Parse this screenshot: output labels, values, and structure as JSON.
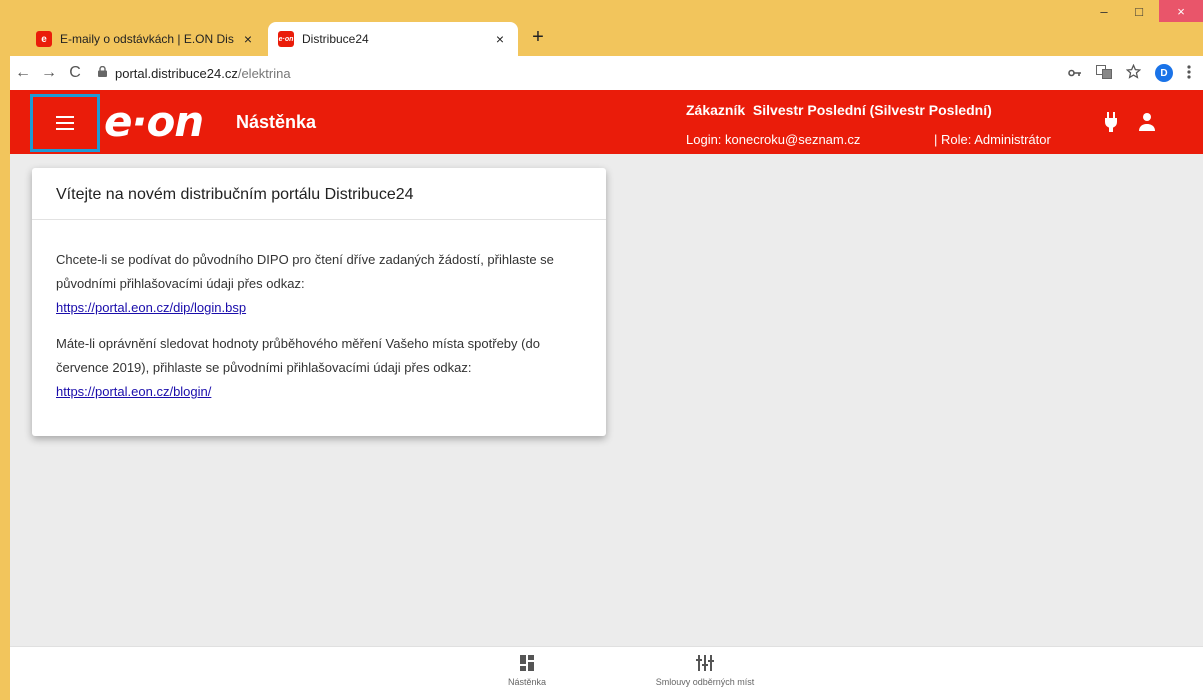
{
  "browser": {
    "tabs": [
      {
        "title": "E-maily o odstávkách | E.ON Dist",
        "favicon": "e",
        "close": "×"
      },
      {
        "title": "Distribuce24",
        "favicon": "e·on",
        "close": "×"
      }
    ],
    "new_tab": "+",
    "window": {
      "minimize": "–",
      "maximize": "□",
      "close": "×"
    },
    "nav": {
      "back": "←",
      "forward": "→",
      "reload": "C"
    },
    "url": {
      "host": "portal.distribuce24.cz",
      "path": "/elektrina"
    },
    "profile_initial": "D",
    "icons": [
      "key-icon",
      "translate-icon",
      "star-icon",
      "more-icon"
    ]
  },
  "header": {
    "logo": "e·on",
    "title": "Nástěnka",
    "customer_label": "Zákazník",
    "customer_name": "Silvestr Poslední (Silvestr Poslední)",
    "login": "Login: konecroku@seznam.cz",
    "role": "| Role: Administrátor",
    "accent_color": "#ea1c0a"
  },
  "card": {
    "title": "Vítejte na novém distribučním portálu Distribuce24",
    "para1_text": "Chcete-li se podívat do původního DIPO pro čtení dříve zadaných žádostí, přihlaste se původními přihlašovacími údaji přes odkaz:",
    "para1_link": "https://portal.eon.cz/dip/login.bsp",
    "para2_text": "Máte-li oprávnění sledovat hodnoty průběhového měření Vašeho místa spotřeby (do července 2019), přihlaste se původními přihlašovacími údaji přes odkaz:",
    "para2_link": "https://portal.eon.cz/blogin/"
  },
  "bottom_nav": {
    "dashboard": "Nástěnka",
    "contracts": "Smlouvy odběrných míst"
  }
}
